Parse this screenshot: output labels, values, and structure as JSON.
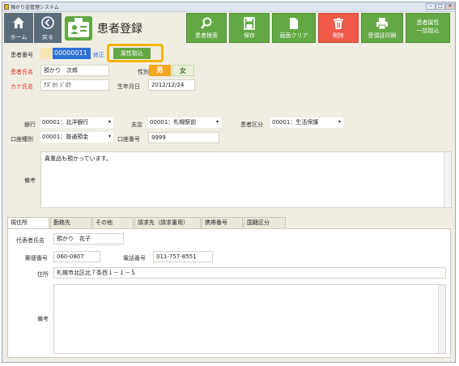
{
  "window": {
    "title": "預かり金管理システム",
    "min": "‒",
    "max": "□",
    "close": "✕"
  },
  "toolbar": {
    "home": "ホーム",
    "back": "戻る",
    "title": "患者登録",
    "search": "患者検索",
    "save": "保存",
    "clear": "画面クリア",
    "delete": "削除",
    "print": "受領証印刷",
    "bulk_line1": "患者属性",
    "bulk_line2": "一括取込"
  },
  "form": {
    "patient_no_label": "患者番号",
    "patient_no": "00000011",
    "edit_link": "修正",
    "attr_button": "属性取込",
    "name_label": "患者氏名",
    "name": "預かり　次郎",
    "gender_label": "性別",
    "male": "男",
    "female": "女",
    "kana_label": "カナ氏名",
    "kana": "ｱｽﾞｶﾘ ｼﾞﾛｳ",
    "dob_label": "生年月日",
    "dob": "2012/12/24",
    "bank_label": "銀行",
    "bank": "00001：北洋銀行",
    "branch_label": "支店",
    "branch": "00001：札幌駅前",
    "pclass_label": "患者区分",
    "pclass": "00001：生活保護",
    "acct_type_label": "口座種別",
    "acct_type": "00001：普通預金",
    "acct_no_label": "口座番号",
    "acct_no": "9999",
    "memo_label": "備考",
    "memo": "貴重品も預かっています。"
  },
  "tabs": [
    "現住所",
    "勤務先",
    "その他",
    "請求先（請求書用）",
    "携帯番号",
    "国籍区分"
  ],
  "address": {
    "rep_label": "代表者氏名",
    "rep": "預かり　花子",
    "zip_label": "郵便番号",
    "zip": "060-0807",
    "tel_label": "電話番号",
    "tel": "011-757-8551",
    "addr_label": "住所",
    "addr": "札幌市北区北７条西１－１－５",
    "memo_label": "備考",
    "memo": ""
  },
  "colors": {
    "green": "#63a845",
    "red": "#ef5a4a",
    "male": "#f5a623",
    "highlight": "#f5b400"
  }
}
